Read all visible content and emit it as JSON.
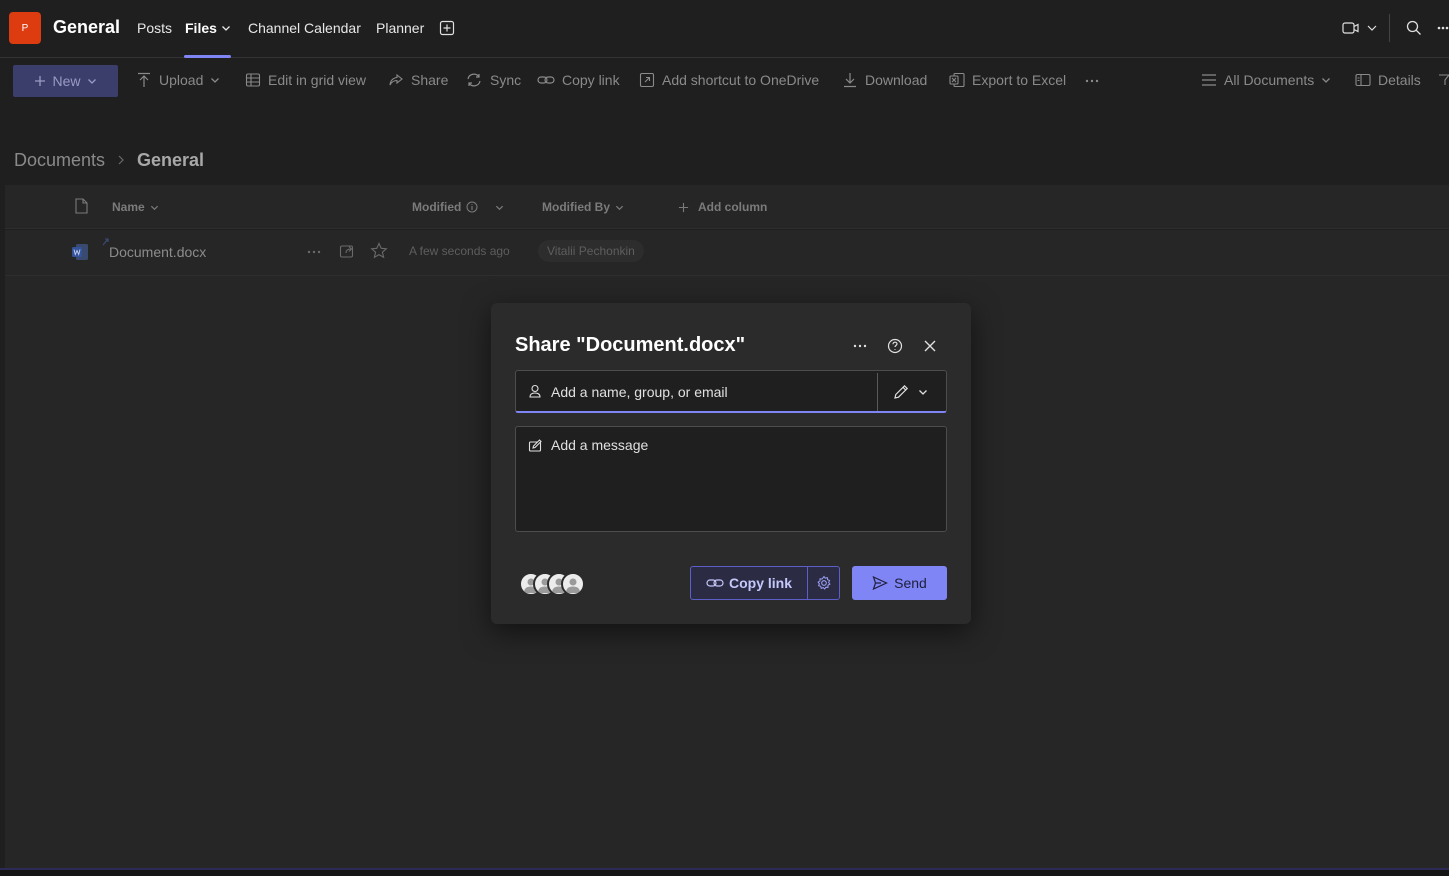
{
  "header": {
    "team_initial": "P",
    "channel_name": "General",
    "tabs": [
      {
        "label": "Posts"
      },
      {
        "label": "Files"
      },
      {
        "label": "Channel Calendar"
      },
      {
        "label": "Planner"
      }
    ]
  },
  "commandbar": {
    "new_label": "New",
    "upload_label": "Upload",
    "edit_grid_label": "Edit in grid view",
    "share_label": "Share",
    "sync_label": "Sync",
    "copy_link_label": "Copy link",
    "shortcut_label": "Add shortcut to OneDrive",
    "download_label": "Download",
    "export_label": "Export to Excel",
    "view_label": "All Documents",
    "details_label": "Details"
  },
  "breadcrumb": {
    "root": "Documents",
    "current": "General"
  },
  "list": {
    "columns": {
      "name": "Name",
      "modified": "Modified",
      "modified_by": "Modified By",
      "add_column": "Add column"
    },
    "rows": [
      {
        "name": "Document.docx",
        "modified": "A few seconds ago",
        "modified_by": "Vitalii Pechonkin"
      }
    ]
  },
  "dialog": {
    "title": "Share \"Document.docx\"",
    "people_placeholder": "Add a name, group, or email",
    "message_placeholder": "Add a message",
    "copy_link_label": "Copy link",
    "send_label": "Send"
  },
  "colors": {
    "accent": "#7f85f5",
    "background": "#1f1f1f",
    "dialog_bg": "#2b2b2b",
    "team_tile": "#dd3c10"
  }
}
